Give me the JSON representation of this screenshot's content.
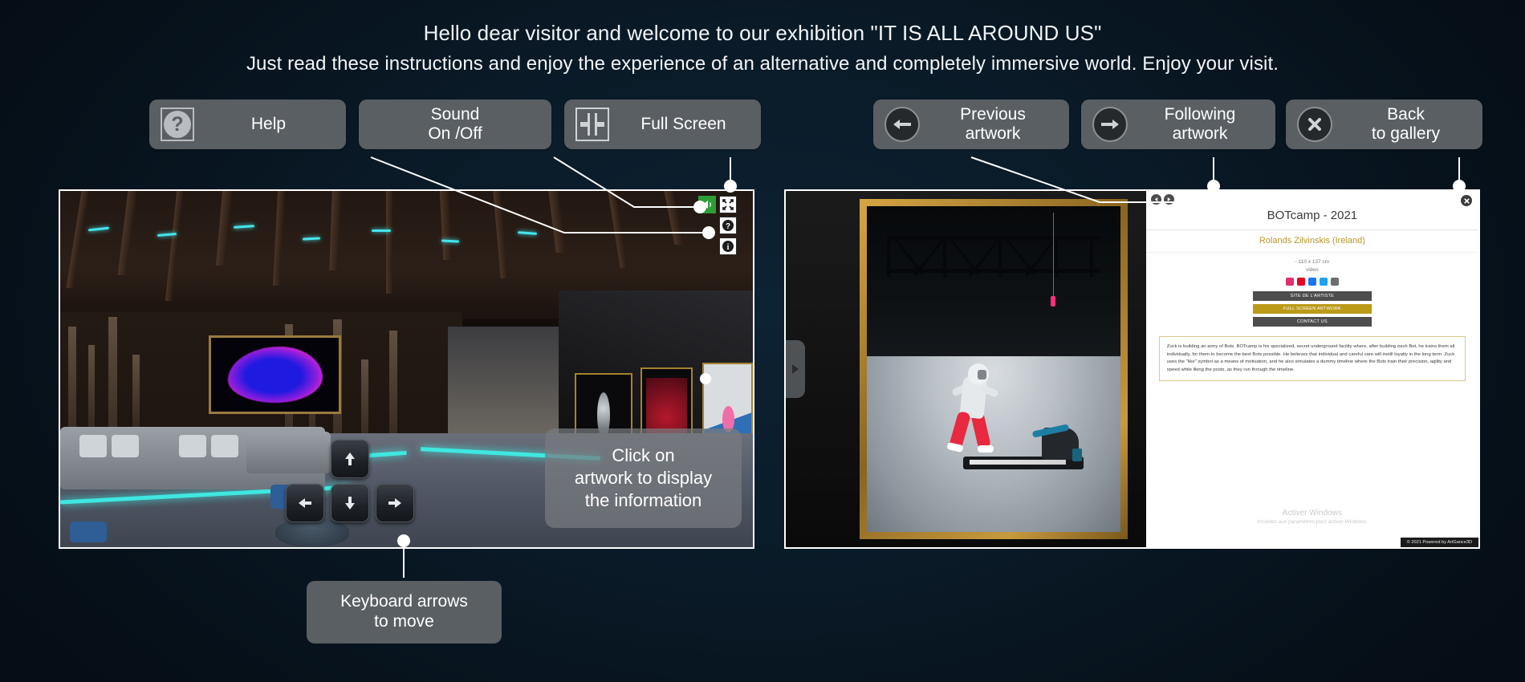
{
  "header": {
    "line1": "Hello dear visitor and welcome to our exhibition \"IT IS ALL AROUND US\"",
    "line2": "Just read these instructions and enjoy the experience of an alternative and completely immersive world. Enjoy your visit."
  },
  "toolbar": {
    "help": {
      "label": "Help",
      "sub": "",
      "icon": "question-mark-icon"
    },
    "sound": {
      "label": "Sound",
      "sub": "On /Off",
      "icon": "speaker-icon"
    },
    "fullscreen": {
      "label": "Full Screen",
      "sub": "",
      "icon": "expand-icon"
    },
    "previous": {
      "label": "Previous",
      "sub": "artwork",
      "icon": "arrow-left-circle-icon"
    },
    "following": {
      "label": "Following",
      "sub": "artwork",
      "icon": "arrow-right-circle-icon"
    },
    "back": {
      "label": "Back",
      "sub": "to gallery",
      "icon": "close-circle-icon"
    }
  },
  "callouts": {
    "keyboard": {
      "line1": "Keyboard arrows",
      "line2": "to move"
    }
  },
  "gallery_panel": {
    "scene_tip": {
      "line1": "Click on",
      "line2": "artwork to display",
      "line3": "the information"
    },
    "overlay_icons": [
      {
        "name": "sound-icon",
        "glyph": "speaker",
        "color": "#2e9c37"
      },
      {
        "name": "fullscreen-icon",
        "glyph": "expand",
        "color": "#ffffff"
      },
      {
        "name": "help-icon",
        "glyph": "question",
        "color": "#ffffff"
      },
      {
        "name": "info-icon",
        "glyph": "info",
        "color": "#ffffff"
      }
    ],
    "keys": [
      "arrow-up",
      "arrow-left",
      "arrow-down",
      "arrow-right"
    ]
  },
  "artwork_panel": {
    "title": "BOTcamp - 2021",
    "artist": "Rolands Zilvinskis (Ireland)",
    "dimensions": "- 110 x 137 cm",
    "medium": "video",
    "socials": [
      {
        "name": "instagram-icon",
        "color": "#e1306c"
      },
      {
        "name": "pinterest-icon",
        "color": "#e60023"
      },
      {
        "name": "facebook-icon",
        "color": "#1877f2"
      },
      {
        "name": "twitter-icon",
        "color": "#1da1f2"
      },
      {
        "name": "email-icon",
        "color": "#6e6e6e"
      }
    ],
    "buttons": [
      {
        "label": "SITE DE L'ARTISTE",
        "style": "dark"
      },
      {
        "label": "FULL SCREEN ARTWORK",
        "style": "gold"
      },
      {
        "label": "CONTACT US",
        "style": "dark"
      }
    ],
    "description": "Zuck is building an army of Bots. BOTcamp is his specialized, secret underground facility where, after building each Bot, he trains them all individually, for them to become the best Bots possible. He believes that individual and careful care will instill loyalty in the long term. Zuck uses the \"like\" symbol as a means of motivation, and he also simulates a dummy timeline where the Bots train their precision, agility and speed while liking the posts, as they run through the timeline.",
    "watermark": {
      "line1": "Activer Windows",
      "line2": "Accédez aux paramètres pour activer Windows."
    },
    "footer": "© 2021 Powered by ArtGance3D"
  },
  "colors": {
    "page_background": "#0a1a27",
    "button_grey": "#5a5f64",
    "accent_gold": "#b99528",
    "sound_green": "#2e9c37",
    "neon_cyan": "#3fe7e0",
    "neon_magenta": "#ff2ec0"
  }
}
